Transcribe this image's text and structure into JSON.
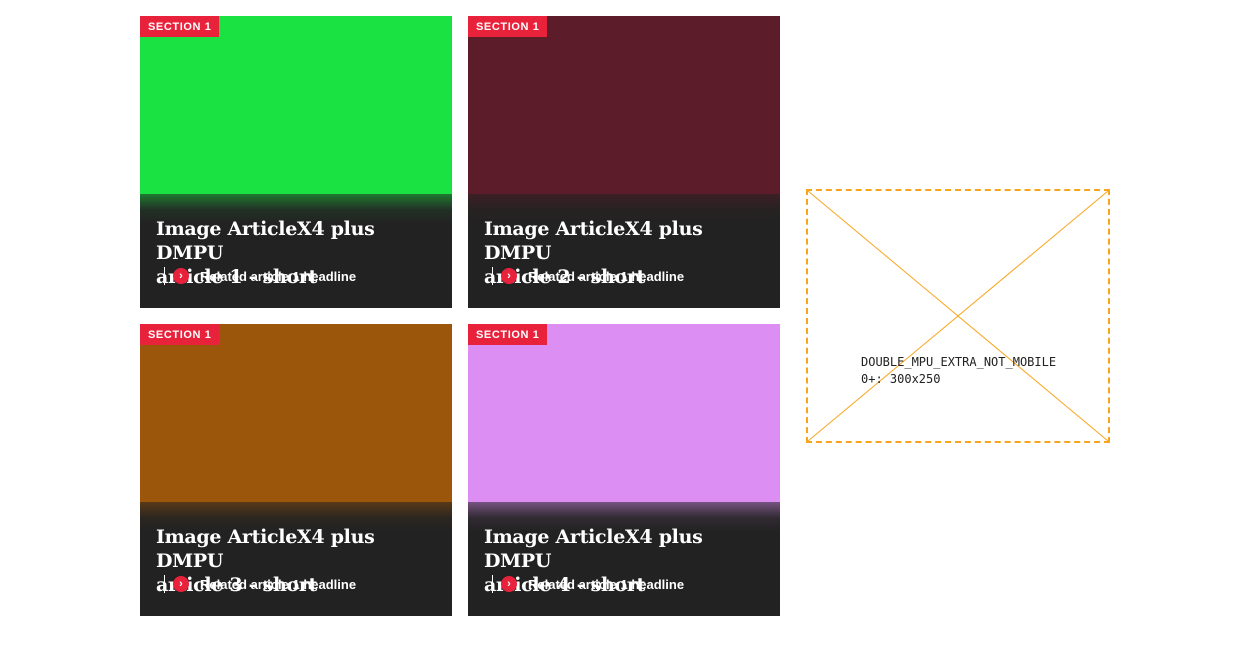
{
  "colors": {
    "badge": "#e8223b",
    "overlay": "#222222",
    "placeholder_border": "#f7a51d"
  },
  "cards": [
    {
      "section": "SECTION 1",
      "image_color": "#1be243",
      "headline_line1": "Image ArticleX4 plus DMPU",
      "headline_line2": "article 1 - short",
      "related": "Related article 1 headline"
    },
    {
      "section": "SECTION 1",
      "image_color": "#5c1c29",
      "headline_line1": "Image ArticleX4 plus DMPU",
      "headline_line2": "article 2 - short",
      "related": "Related article 1 headline"
    },
    {
      "section": "SECTION 1",
      "image_color": "#9c560b",
      "headline_line1": "Image ArticleX4 plus DMPU",
      "headline_line2": "article 3 - short",
      "related": "Related article 1 headline"
    },
    {
      "section": "SECTION 1",
      "image_color": "#dd8ef2",
      "headline_line1": "Image ArticleX4 plus DMPU",
      "headline_line2": "article 4 - short",
      "related": "Related article 1 headline"
    }
  ],
  "ad_placeholder": {
    "slot_name": "DOUBLE_MPU_EXTRA_NOT_MOBILE",
    "size_rule": "0+: 300x250"
  }
}
